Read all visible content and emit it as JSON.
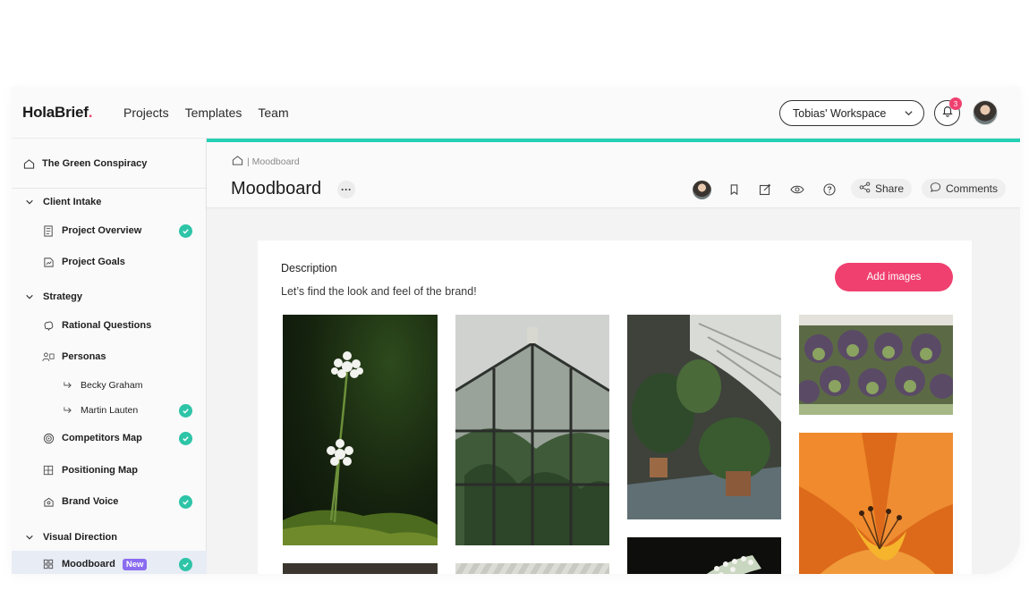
{
  "brand": {
    "name": "HolaBrief",
    "dot": "."
  },
  "nav": {
    "links": [
      "Projects",
      "Templates",
      "Team"
    ]
  },
  "workspace": {
    "label": "Tobias' Workspace"
  },
  "notifications": {
    "count": "3"
  },
  "sidebar": {
    "project": "The Green Conspiracy",
    "sections": {
      "client_intake": "Client Intake",
      "strategy": "Strategy",
      "visual_direction": "Visual Direction"
    },
    "items": {
      "project_overview": "Project Overview",
      "project_goals": "Project Goals",
      "rational_questions": "Rational Questions",
      "personas": "Personas",
      "becky": "Becky Graham",
      "martin": "Martin Lauten",
      "competitors_map": "Competitors Map",
      "positioning_map": "Positioning Map",
      "brand_voice": "Brand Voice",
      "moodboard": "Moodboard"
    },
    "new_tag": "New"
  },
  "main": {
    "breadcrumb": "| Moodboard",
    "title": "Moodboard",
    "more": "···",
    "share": "Share",
    "comments": "Comments"
  },
  "card": {
    "desc_label": "Description",
    "desc_text": "Let’s find the look and feel of the brand!",
    "add_images": "Add images"
  },
  "colors": {
    "accent": "#25d0b4",
    "brand_pink": "#f0406f",
    "check_green": "#2ec4a7",
    "new_purple": "#8a6cf0"
  }
}
